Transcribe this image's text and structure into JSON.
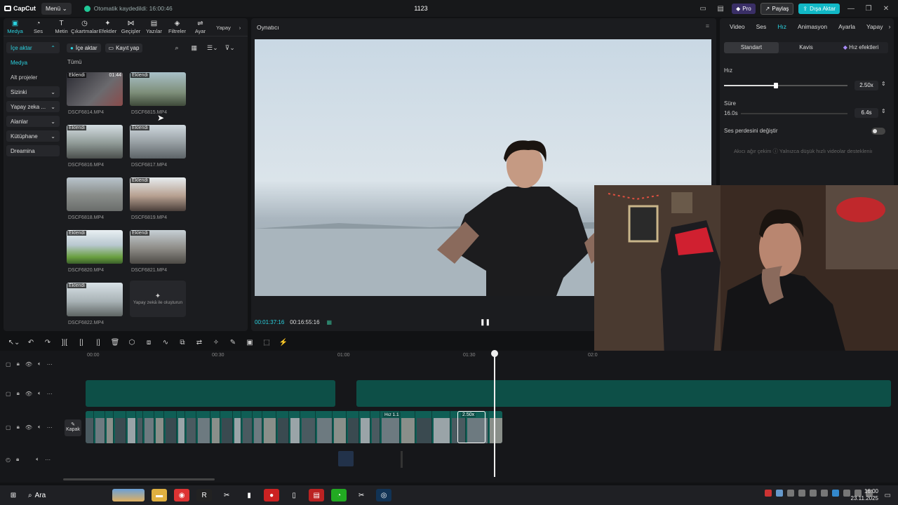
{
  "titlebar": {
    "app_name": "CapCut",
    "menu_label": "Menü",
    "autosave_text": "Otomatik kaydedildi: 16:00:46",
    "project_title": "1123",
    "pro_label": "Pro",
    "share_label": "Paylaş",
    "export_label": "Dışa Aktar"
  },
  "media_tabs": [
    {
      "label": "Medya",
      "icon": "media-icon"
    },
    {
      "label": "Ses",
      "icon": "audio-icon"
    },
    {
      "label": "Metin",
      "icon": "text-icon"
    },
    {
      "label": "Çıkartmalar",
      "icon": "sticker-icon"
    },
    {
      "label": "Efektler",
      "icon": "effects-icon"
    },
    {
      "label": "Geçişler",
      "icon": "transitions-icon"
    },
    {
      "label": "Yazılar",
      "icon": "captions-icon"
    },
    {
      "label": "Filtreler",
      "icon": "filters-icon"
    },
    {
      "label": "Ayar",
      "icon": "adjust-icon"
    },
    {
      "label": "Yapay",
      "icon": "ai-icon"
    }
  ],
  "left_nav": {
    "items": [
      {
        "label": "İçe aktar",
        "style": "sel"
      },
      {
        "label": "Medya",
        "style": "plain"
      },
      {
        "label": "Alt projeler",
        "style": "plain2"
      },
      {
        "label": "Sizinki",
        "style": "box"
      },
      {
        "label": "Yapay zeka ...",
        "style": "box"
      },
      {
        "label": "Alanlar",
        "style": "box"
      },
      {
        "label": "Kütüphane",
        "style": "box"
      },
      {
        "label": "Dreamina",
        "style": "box"
      }
    ]
  },
  "media_toolbar": {
    "import_label": "İçe aktar",
    "record_label": "Kayıt yap",
    "filter_all": "Tümü"
  },
  "media_items": [
    {
      "name": "DSCF6814.MP4",
      "badge": "Eklendi",
      "duration": "01:44"
    },
    {
      "name": "DSCF6815.MP4",
      "badge": "Eklendi",
      "duration": ""
    },
    {
      "name": "DSCF6816.MP4",
      "badge": "Eklendi",
      "duration": ""
    },
    {
      "name": "DSCF6817.MP4",
      "badge": "Eklendi",
      "duration": ""
    },
    {
      "name": "DSCF6818.MP4",
      "badge": "",
      "duration": ""
    },
    {
      "name": "DSCF6819.MP4",
      "badge": "Eklendi",
      "duration": ""
    },
    {
      "name": "DSCF6820.MP4",
      "badge": "Eklendi",
      "duration": ""
    },
    {
      "name": "DSCF6821.MP4",
      "badge": "Eklendi",
      "duration": ""
    },
    {
      "name": "DSCF6822.MP4",
      "badge": "Eklendi",
      "duration": ""
    }
  ],
  "ai_generate_label": "Yapay zekâ ile oluşturun",
  "player": {
    "title": "Oynatıcı",
    "current_time": "00:01:37:16",
    "total_time": "00:16:55:16"
  },
  "right_panel": {
    "tabs": [
      "Video",
      "Ses",
      "Hız",
      "Animasyon",
      "Ayarla",
      "Yapay"
    ],
    "active_tab": "Hız",
    "segments": [
      "Standart",
      "Kavis",
      "Hız efektleri"
    ],
    "speed_label": "Hız",
    "speed_value": "2.50x",
    "speed_level": 0.42,
    "duration_label": "Süre",
    "duration_from": "16.0s",
    "duration_value": "6.4s",
    "pitch_label": "Ses perdesini değiştir",
    "smooth_label": "Akıcı ağır çekim",
    "smooth_hint": "Yalnızca düşük hızlı videolar destekleniı"
  },
  "timeline": {
    "ruler_labels": [
      "00:00",
      "00:30",
      "01:00",
      "01:30",
      "02:0"
    ],
    "cover_label": "Kapak",
    "speed_badge": "2.50x",
    "speed_badge2": "Hız 1.1"
  },
  "taskbar": {
    "search_label": "Ara",
    "time": "16:00",
    "date": "23.11.2025"
  }
}
